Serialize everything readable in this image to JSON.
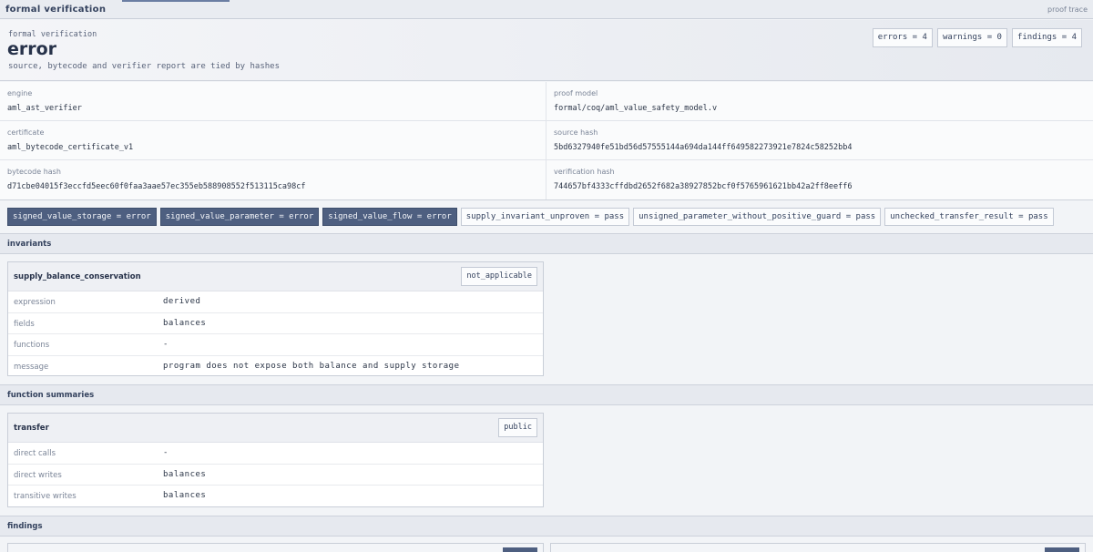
{
  "topbar": {
    "title": "formal verification",
    "link": "proof trace"
  },
  "header": {
    "kicker": "formal verification",
    "status": "error",
    "subtitle": "source, bytecode and verifier report are tied by hashes",
    "counters": [
      "errors = 4",
      "warnings = 0",
      "findings = 4"
    ]
  },
  "meta": {
    "engine": {
      "label": "engine",
      "value": "aml_ast_verifier"
    },
    "proof_model": {
      "label": "proof model",
      "value": "formal/coq/aml_value_safety_model.v"
    },
    "certificate": {
      "label": "certificate",
      "value": "aml_bytecode_certificate_v1"
    },
    "source_hash": {
      "label": "source hash",
      "value": "5bd6327940fe51bd56d57555144a694da144ff649582273921e7824c58252bb4"
    },
    "bytecode_hash": {
      "label": "bytecode hash",
      "value": "d71cbe04015f3eccfd5eec60f0faa3aae57ec355eb588908552f513115ca98cf"
    },
    "verification_hash": {
      "label": "verification hash",
      "value": "744657bf4333cffdbd2652f682a38927852bcf0f5765961621bb42a2ff8eeff6"
    }
  },
  "chips": [
    {
      "label": "signed_value_storage = error",
      "state": "error"
    },
    {
      "label": "signed_value_parameter = error",
      "state": "error"
    },
    {
      "label": "signed_value_flow = error",
      "state": "error"
    },
    {
      "label": "supply_invariant_unproven = pass",
      "state": "pass"
    },
    {
      "label": "unsigned_parameter_without_positive_guard = pass",
      "state": "pass"
    },
    {
      "label": "unchecked_transfer_result = pass",
      "state": "pass"
    }
  ],
  "sections": {
    "invariants": "invariants",
    "function_summaries": "function summaries",
    "findings": "findings"
  },
  "invariant": {
    "name": "supply_balance_conservation",
    "badge": "not_applicable",
    "rows": [
      {
        "label": "expression",
        "value": "derived"
      },
      {
        "label": "fields",
        "value": "balances"
      },
      {
        "label": "functions",
        "value": "-"
      },
      {
        "label": "message",
        "value": "program does not expose both balance and supply storage"
      }
    ]
  },
  "function": {
    "name": "transfer",
    "badge": "public",
    "rows": [
      {
        "label": "direct calls",
        "value": "-"
      },
      {
        "label": "direct writes",
        "value": "balances"
      },
      {
        "label": "transitive writes",
        "value": "balances"
      }
    ]
  },
  "colors": {
    "accent": "#4e5f80",
    "background": "#f2f4f7",
    "text": "#2a3446"
  }
}
